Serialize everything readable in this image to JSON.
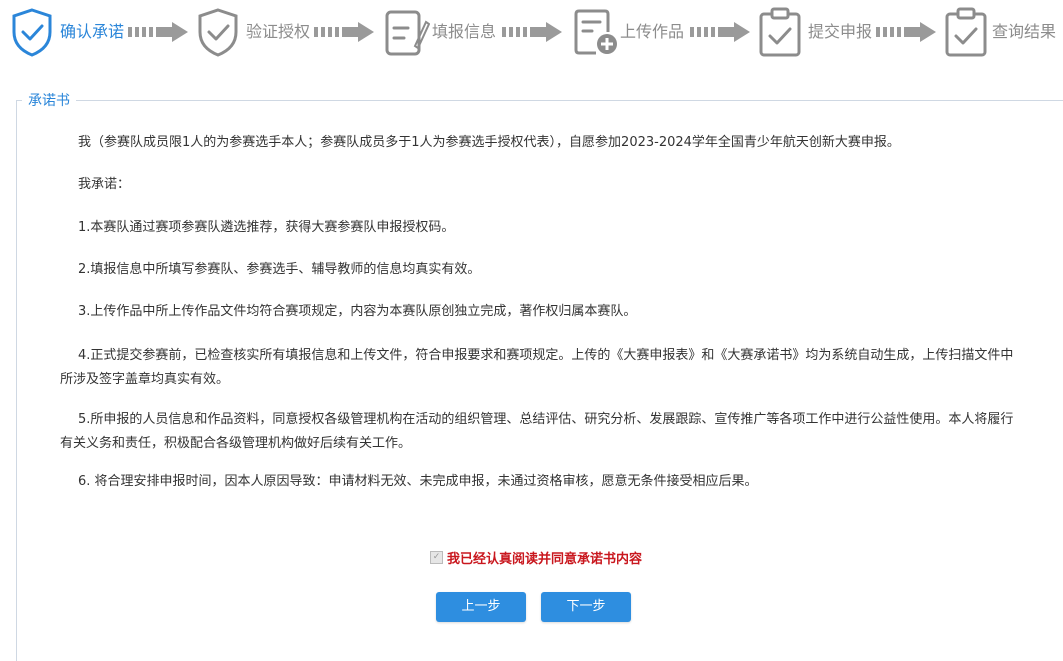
{
  "steps": [
    {
      "label": "确认承诺",
      "icon": "shield-check-icon",
      "active": true
    },
    {
      "label": "验证授权",
      "icon": "shield-check-icon",
      "active": false
    },
    {
      "label": "填报信息",
      "icon": "form-edit-icon",
      "active": false
    },
    {
      "label": "上传作品",
      "icon": "file-upload-icon",
      "active": false
    },
    {
      "label": "提交申报",
      "icon": "clipboard-check-icon",
      "active": false
    },
    {
      "label": "查询结果",
      "icon": "clipboard-check-icon",
      "active": false
    }
  ],
  "colors": {
    "active": "#2b86d9",
    "inactive": "#8c8c8c",
    "button": "#2e8ee0",
    "agree": "#c9171e"
  },
  "pledge": {
    "legend": "承诺书",
    "paragraphs": [
      "我（参赛队成员限1人的为参赛选手本人；参赛队成员多于1人为参赛选手授权代表），自愿参加2023-2024学年全国青少年航天创新大赛申报。",
      "我承诺：",
      "1.本赛队通过赛项参赛队遴选推荐，获得大赛参赛队申报授权码。",
      "2.填报信息中所填写参赛队、参赛选手、辅导教师的信息均真实有效。",
      "3.上传作品中所上传作品文件均符合赛项规定，内容为本赛队原创独立完成，著作权归属本赛队。",
      "4.正式提交参赛前，已检查核实所有填报信息和上传文件，符合申报要求和赛项规定。上传的《大赛申报表》和《大赛承诺书》均为系统自动生成，上传扫描文件中所涉及签字盖章均真实有效。",
      "5.所申报的人员信息和作品资料，同意授权各级管理机构在活动的组织管理、总结评估、研究分析、发展跟踪、宣传推广等各项工作中进行公益性使用。本人将履行有关义务和责任，积极配合各级管理机构做好后续有关工作。",
      "6. 将合理安排申报时间，因本人原因导致：申请材料无效、未完成申报，未通过资格审核，愿意无条件接受相应后果。"
    ],
    "agree_label": "我已经认真阅读并同意承诺书内容",
    "agree_checked": true
  },
  "buttons": {
    "prev": "上一步",
    "next": "下一步"
  }
}
